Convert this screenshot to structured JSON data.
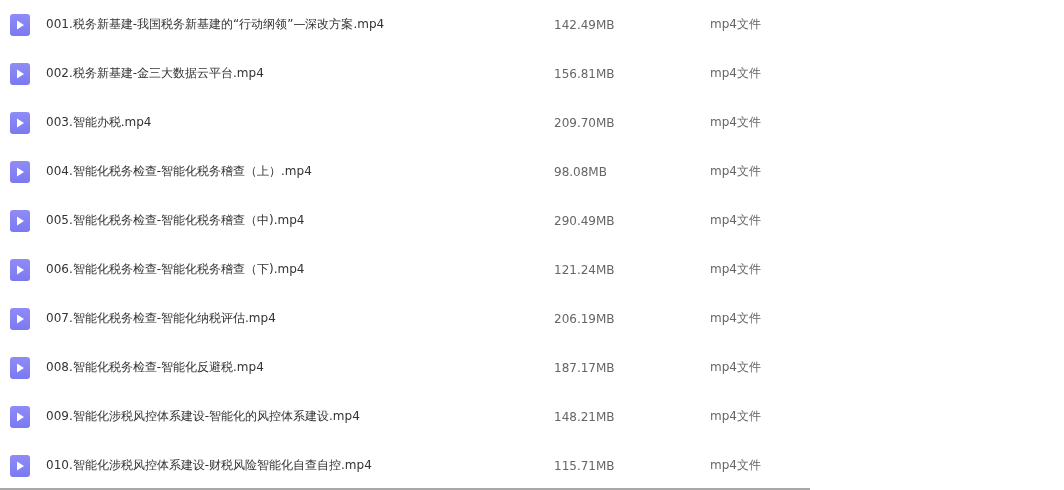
{
  "files": [
    {
      "name": "001.税务新基建-我国税务新基建的“行动纲领”—深改方案.mp4",
      "size": "142.49MB",
      "type": "mp4文件"
    },
    {
      "name": "002.税务新基建-金三大数据云平台.mp4",
      "size": "156.81MB",
      "type": "mp4文件"
    },
    {
      "name": "003.智能办税.mp4",
      "size": "209.70MB",
      "type": "mp4文件"
    },
    {
      "name": "004.智能化税务检查-智能化税务稽查（上）.mp4",
      "size": "98.08MB",
      "type": "mp4文件"
    },
    {
      "name": "005.智能化税务检查-智能化税务稽查（中).mp4",
      "size": "290.49MB",
      "type": "mp4文件"
    },
    {
      "name": "006.智能化税务检查-智能化税务稽查（下).mp4",
      "size": "121.24MB",
      "type": "mp4文件"
    },
    {
      "name": "007.智能化税务检查-智能化纳税评估.mp4",
      "size": "206.19MB",
      "type": "mp4文件"
    },
    {
      "name": "008.智能化税务检查-智能化反避税.mp4",
      "size": "187.17MB",
      "type": "mp4文件"
    },
    {
      "name": "009.智能化涉税风控体系建设-智能化的风控体系建设.mp4",
      "size": "148.21MB",
      "type": "mp4文件"
    },
    {
      "name": "010.智能化涉税风控体系建设-财税风险智能化自查自控.mp4",
      "size": "115.71MB",
      "type": "mp4文件"
    }
  ]
}
